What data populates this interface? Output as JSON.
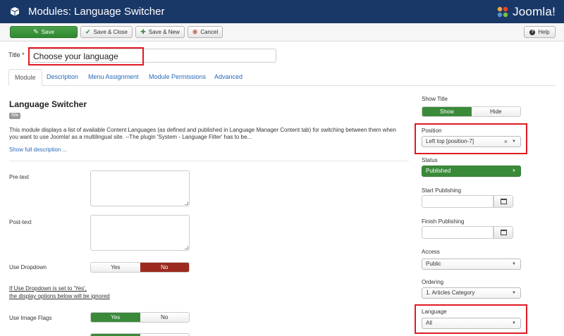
{
  "header": {
    "title": "Modules: Language Switcher",
    "brand": "Joomla!",
    "bar_color": "#1a3867"
  },
  "toolbar": {
    "save": "Save",
    "save_close": "Save & Close",
    "save_new": "Save & New",
    "cancel": "Cancel",
    "help": "Help"
  },
  "form": {
    "title_label": "Title *",
    "title_value": "Choose your language"
  },
  "tabs": [
    "Module",
    "Description",
    "Menu Assignment",
    "Module Permissions",
    "Advanced"
  ],
  "module": {
    "name": "Language Switcher",
    "badge": "Site",
    "description_line1": "This module displays a list of available Content Languages (as defined and published in Language Manager Content tab) for switching between them when",
    "description_line2": "you want to use Joomla! as a multilingual site. --The plugin 'System - Language Filter' has to be...",
    "show_full": "Show full description ..."
  },
  "fields": {
    "pretext_label": "Pre-text",
    "posttext_label": "Post-text",
    "use_dropdown_label": "Use Dropdown",
    "yes": "Yes",
    "no": "No",
    "note_line1": "If Use Dropdown is set to 'Yes',",
    "note_line2": "the display options below will be ignored",
    "use_flags_label": "Use Image Flags"
  },
  "sidebar": {
    "show_title_label": "Show Title",
    "show": "Show",
    "hide": "Hide",
    "position_label": "Position",
    "position_value": "Left top [position-7]",
    "status_label": "Status",
    "status_value": "Published",
    "start_label": "Start Publishing",
    "finish_label": "Finish Publishing",
    "access_label": "Access",
    "access_value": "Public",
    "ordering_label": "Ordering",
    "ordering_value": "1. Articles Category",
    "language_label": "Language",
    "language_value": "All"
  },
  "colors": {
    "highlight": "#e01a24",
    "success": "#3a8a3a",
    "danger": "#9c2a1f",
    "link": "#2a69b8"
  }
}
